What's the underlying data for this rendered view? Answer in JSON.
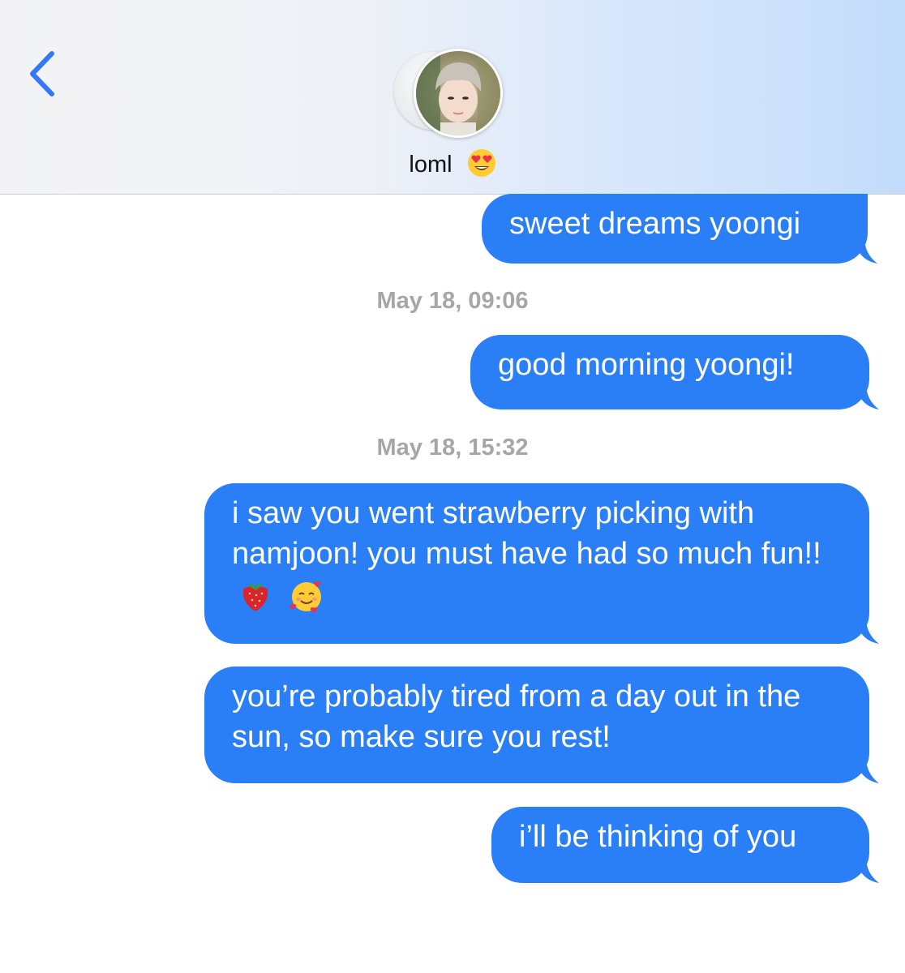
{
  "header": {
    "contact_name": "loml",
    "name_emoji": "heart-eyes-emoji",
    "back_icon": "chevron-left-icon"
  },
  "colors": {
    "accent_blue": "#2b7ff6",
    "back_chevron": "#3478f6",
    "timestamp_gray": "#a5a5aa"
  },
  "messages": [
    {
      "text": "sweet dreams yoongi",
      "sender": "me"
    },
    {
      "timestamp": "May 18, 09:06"
    },
    {
      "text": "good morning yoongi!",
      "sender": "me"
    },
    {
      "timestamp": "May 18, 15:32"
    },
    {
      "text": "i saw you went strawberry picking with namjoon! you must have had so much fun!!",
      "emojis": [
        "strawberry-emoji",
        "smiling-face-with-hearts-emoji"
      ],
      "sender": "me"
    },
    {
      "text": "you’re probably tired from a day out in the sun, so make sure you rest!",
      "sender": "me"
    },
    {
      "text": "i’ll be thinking of you",
      "sender": "me"
    }
  ]
}
